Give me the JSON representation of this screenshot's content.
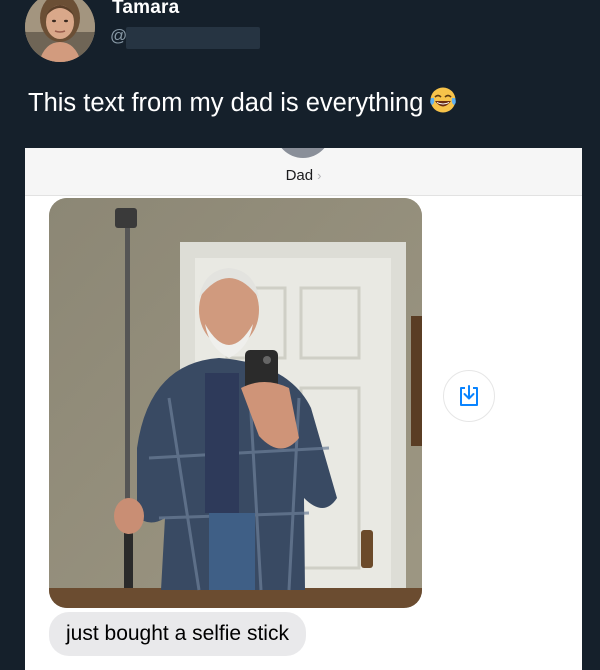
{
  "tweet": {
    "author": {
      "display_name": "Tamara",
      "handle_prefix": "@"
    },
    "text": "This text from my dad is everything",
    "emoji": "face-with-tears-of-joy"
  },
  "screenshot": {
    "contact": {
      "name": "Dad",
      "chevron": "›"
    },
    "photo": {
      "subject": "selfie-stick-mirror-photo"
    },
    "message": "just bought a selfie stick",
    "save_icon": "save-to-device-icon"
  },
  "colors": {
    "background": "#15202b",
    "received_bubble": "#e9e9eb",
    "ios_blue": "#0a84ff"
  }
}
